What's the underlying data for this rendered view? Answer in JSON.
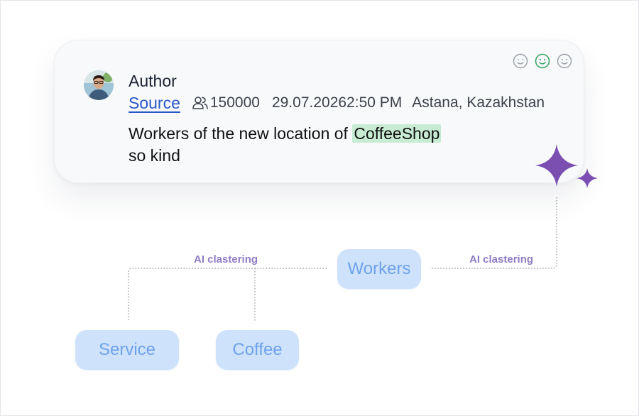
{
  "post": {
    "author": "Author",
    "source_label": "Source",
    "audience": "150000",
    "datetime": "29.07.20262:50 PM",
    "location": "Astana, Kazakhstan",
    "text_before": "Workers of the new location of ",
    "text_highlight": "CoffeeShop",
    "text_after": "so kind",
    "reaction_icons": [
      "smile-outline-icon",
      "smile-active-icon",
      "smile-outline-icon"
    ]
  },
  "clustering": {
    "label_left": "AI clastering",
    "label_right": "AI clastering"
  },
  "tags": {
    "workers": "Workers",
    "service": "Service",
    "coffee": "Coffee"
  },
  "colors": {
    "sparkle": "#7b4fb1",
    "tag_bg": "#cfe2fc",
    "tag_text": "#6ea2ec",
    "label": "#8f7cc4",
    "highlight": "#c8ecd3",
    "link": "#2a56c6",
    "reaction_active": "#3aa767"
  }
}
